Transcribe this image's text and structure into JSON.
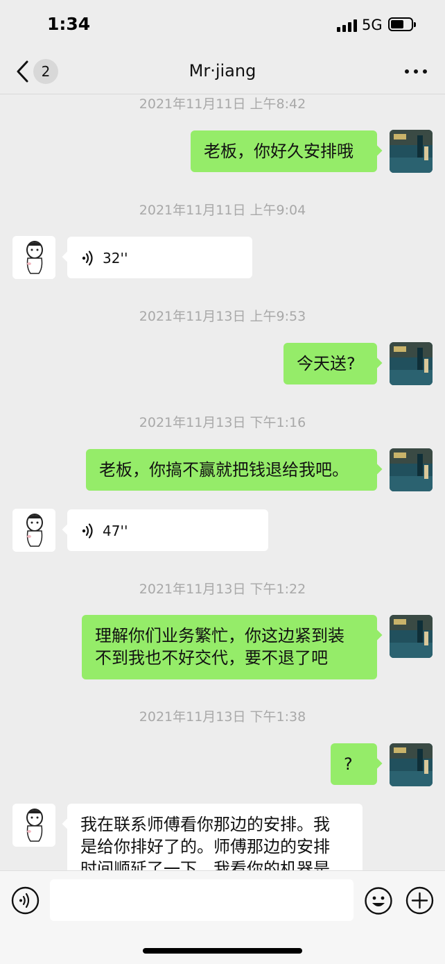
{
  "status": {
    "time": "1:34",
    "network": "5G"
  },
  "nav": {
    "unread_count": "2",
    "title": "Mr·jiang"
  },
  "messages": [
    {
      "type": "timestamp",
      "text": "2021年11月11日 上午8:42"
    },
    {
      "type": "text",
      "direction": "out",
      "text": "老板，你好久安排哦"
    },
    {
      "type": "timestamp",
      "text": "2021年11月11日 上午9:04"
    },
    {
      "type": "voice",
      "direction": "in",
      "duration": "32''"
    },
    {
      "type": "timestamp",
      "text": "2021年11月13日 上午9:53"
    },
    {
      "type": "text",
      "direction": "out",
      "text": "今天送?"
    },
    {
      "type": "timestamp",
      "text": "2021年11月13日 下午1:16"
    },
    {
      "type": "text",
      "direction": "out",
      "text": "老板，你搞不赢就把钱退给我吧。"
    },
    {
      "type": "voice",
      "direction": "in",
      "duration": "47''"
    },
    {
      "type": "timestamp",
      "text": "2021年11月13日 下午1:22"
    },
    {
      "type": "text",
      "direction": "out",
      "lines": [
        "理解你们业务繁忙，你这边紧到装",
        "不到我也不好交代，要不退了吧"
      ]
    },
    {
      "type": "timestamp",
      "text": "2021年11月13日 下午1:38"
    },
    {
      "type": "text",
      "direction": "out",
      "text": "?"
    },
    {
      "type": "text",
      "direction": "in",
      "lines": [
        "我在联系师傅看你那边的安排。我",
        "是给你排好了的。师傅那边的安排",
        "时间顺延了一下，我看你的机器是"
      ]
    }
  ],
  "input": {
    "placeholder": ""
  },
  "icons": {
    "back": "chevron-left-icon",
    "more": "more-dots-icon",
    "voice_message": "voice-wave-icon",
    "voice_toggle": "voice-input-icon",
    "emoji": "emoji-icon",
    "plus": "plus-icon"
  },
  "colors": {
    "outgoing_bubble": "#95ec69",
    "incoming_bubble": "#ffffff",
    "background": "#ededed",
    "timestamp_text": "#a8a8a8"
  }
}
